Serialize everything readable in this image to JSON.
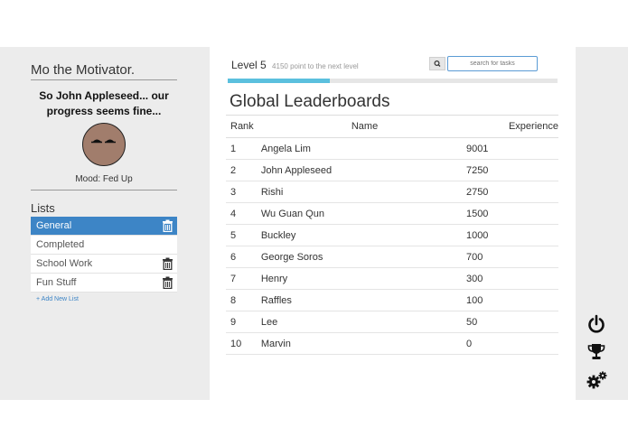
{
  "sidebar": {
    "bot_name": "Mo the Motivator.",
    "bot_message": "So John Appleseed... our progress seems fine...",
    "mood": "Mood: Fed Up",
    "lists_title": "Lists",
    "lists": [
      {
        "label": "General",
        "active": true,
        "deletable": true
      },
      {
        "label": "Completed",
        "active": false,
        "deletable": false
      },
      {
        "label": "School Work",
        "active": false,
        "deletable": true
      },
      {
        "label": "Fun Stuff",
        "active": false,
        "deletable": true
      }
    ],
    "add_list": "+ Add New List"
  },
  "header": {
    "level": "Level 5",
    "level_sub": "4150 point to the next level",
    "search_placeholder": "search for tasks",
    "progress_fraction": 0.31
  },
  "leaderboard": {
    "title": "Global Leaderboards",
    "columns": [
      "Rank",
      "Name",
      "Experience"
    ],
    "rows": [
      {
        "rank": "1",
        "name": "Angela Lim",
        "exp": "9001"
      },
      {
        "rank": "2",
        "name": "John Appleseed",
        "exp": "7250"
      },
      {
        "rank": "3",
        "name": "Rishi",
        "exp": "2750"
      },
      {
        "rank": "4",
        "name": "Wu Guan Qun",
        "exp": "1500"
      },
      {
        "rank": "5",
        "name": "Buckley",
        "exp": "1000"
      },
      {
        "rank": "6",
        "name": "George Soros",
        "exp": "700"
      },
      {
        "rank": "7",
        "name": "Henry",
        "exp": "300"
      },
      {
        "rank": "8",
        "name": "Raffles",
        "exp": "100"
      },
      {
        "rank": "9",
        "name": "Lee",
        "exp": "50"
      },
      {
        "rank": "10",
        "name": "Marvin",
        "exp": "0"
      }
    ]
  },
  "rightbar": {
    "icons": [
      "power-icon",
      "trophy-icon",
      "settings-gears-icon"
    ]
  },
  "colors": {
    "accent": "#3d85c6",
    "progress": "#5bc0de",
    "panel": "#ececec"
  }
}
